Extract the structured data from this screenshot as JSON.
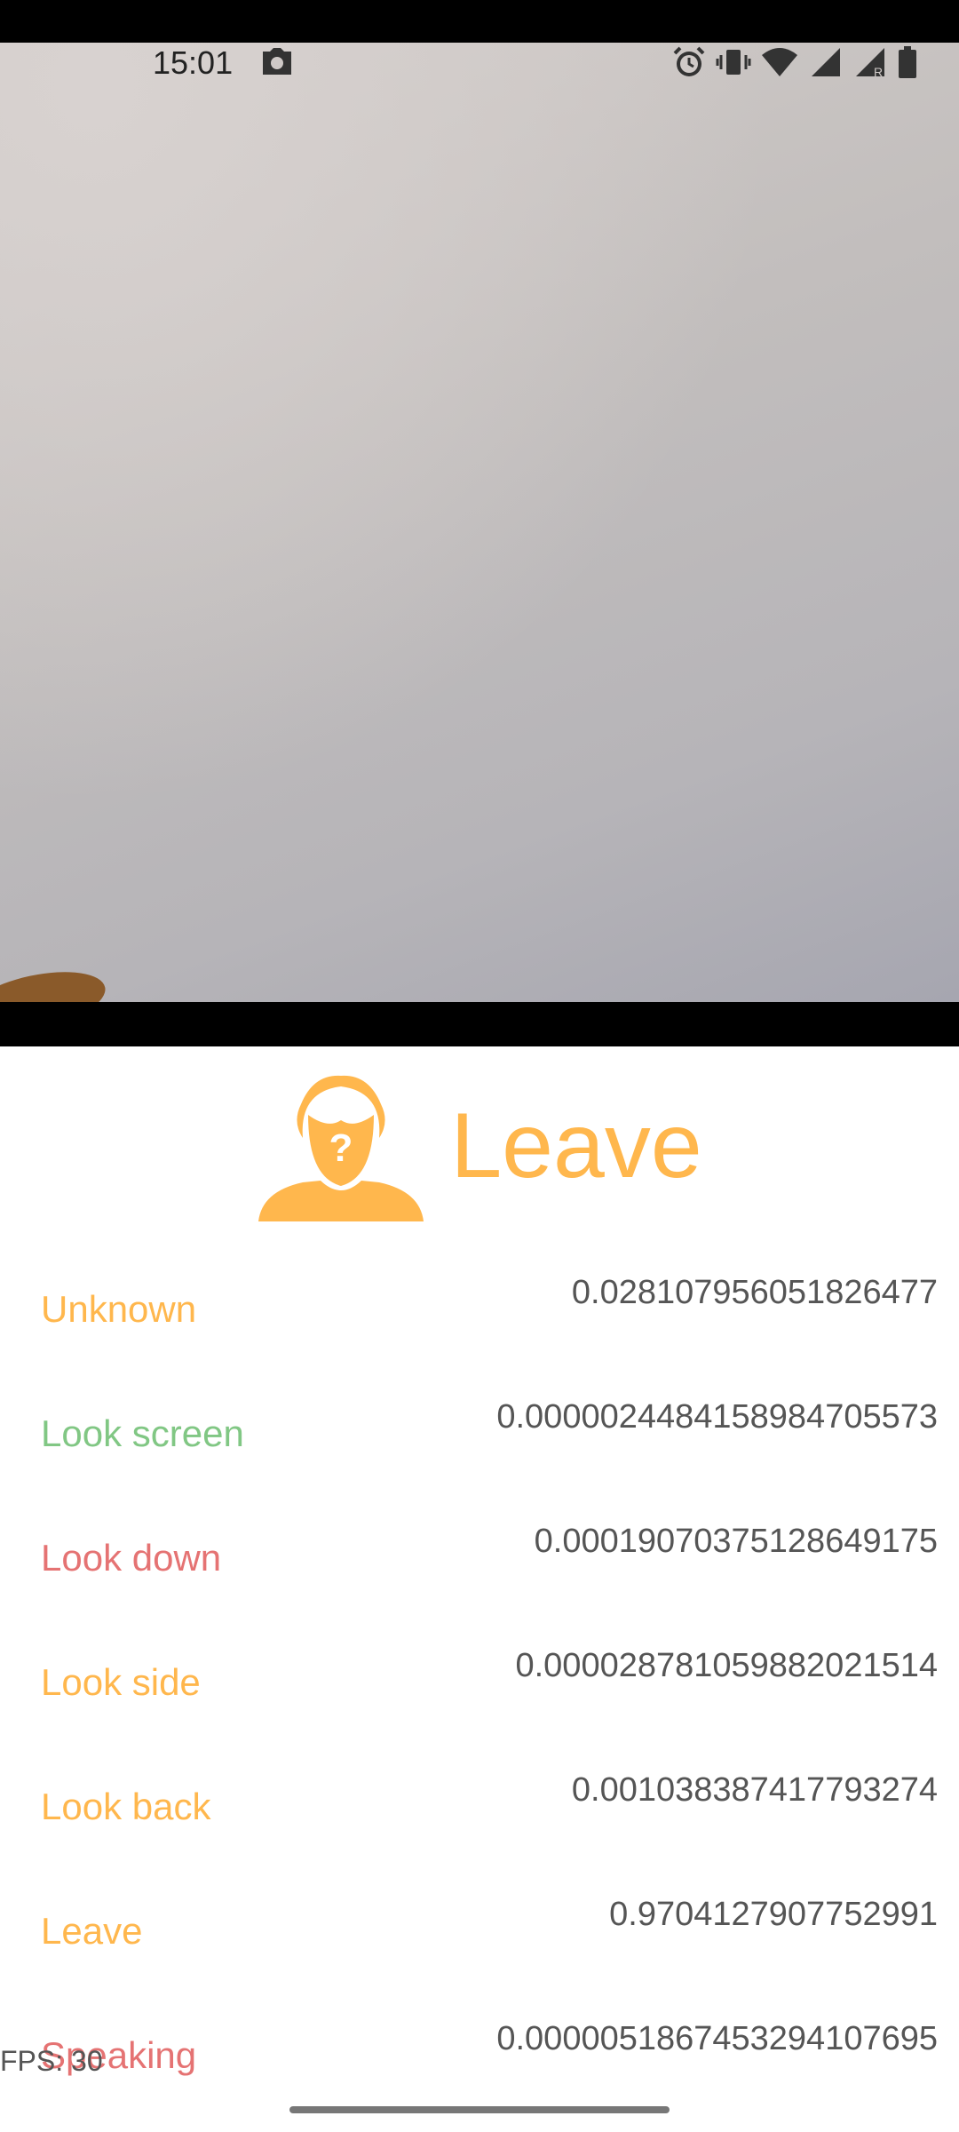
{
  "status_bar": {
    "time": "15:01",
    "icons": [
      "camera-icon",
      "alarm-icon",
      "vibrate-icon",
      "wifi-icon",
      "signal-icon",
      "signal-roaming-icon",
      "battery-icon"
    ]
  },
  "result": {
    "title": "Leave",
    "icon": "person-question-icon",
    "color": "#ffb74d"
  },
  "scores": [
    {
      "label": "Unknown",
      "value": "0.028107956051826477",
      "color": "#ffb74d"
    },
    {
      "label": "Look screen",
      "value": "0.0000024484158984705573",
      "color": "#81c784"
    },
    {
      "label": "Look down",
      "value": "0.00019070375128649175",
      "color": "#e57373"
    },
    {
      "label": "Look side",
      "value": "0.000028781059882021514",
      "color": "#ffb74d"
    },
    {
      "label": "Look back",
      "value": "0.001038387417793274",
      "color": "#ffb74d"
    },
    {
      "label": "Leave",
      "value": "0.9704127907752991",
      "color": "#ffb74d"
    },
    {
      "label": "Speaking",
      "value": "0.0000051867453294107695",
      "color": "#e57373"
    }
  ],
  "fps": "FPS: 30"
}
